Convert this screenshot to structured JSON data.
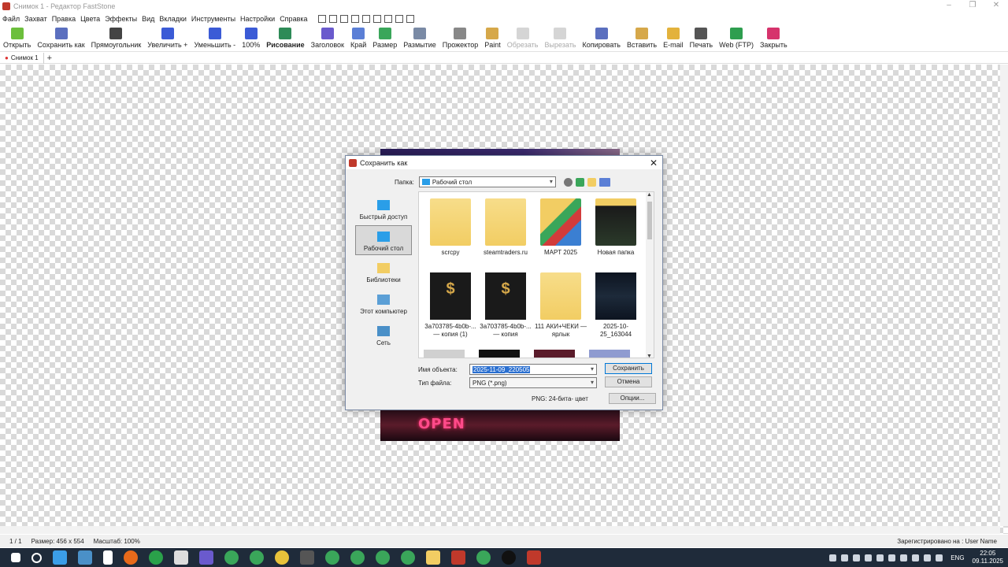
{
  "window": {
    "title": "Снимок 1 - Редактор FastStone",
    "controls": [
      "–",
      "❐",
      "✕"
    ]
  },
  "menu": [
    "Файл",
    "Захват",
    "Правка",
    "Цвета",
    "Эффекты",
    "Вид",
    "Вкладки",
    "Инструменты",
    "Настройки",
    "Справка"
  ],
  "toolbar": [
    {
      "label": "Открыть",
      "icon": "open-folder-icon",
      "color": "#6cbf3c",
      "disabled": false
    },
    {
      "label": "Сохранить как",
      "icon": "save-icon",
      "color": "#5b6fbf",
      "disabled": false
    },
    {
      "label": "Прямоугольник",
      "icon": "rectangle-select-icon",
      "color": "#444444",
      "disabled": false
    },
    {
      "label": "Увеличить +",
      "icon": "zoom-in-icon",
      "color": "#3b5bd6",
      "disabled": false
    },
    {
      "label": "Уменьшить -",
      "icon": "zoom-out-icon",
      "color": "#3b5bd6",
      "disabled": false
    },
    {
      "label": "100%",
      "icon": "zoom-100-icon",
      "color": "#3b5bd6",
      "disabled": false
    },
    {
      "label": "Рисование",
      "icon": "draw-icon",
      "color": "#2e8b57",
      "disabled": false,
      "bold": true
    },
    {
      "label": "Заголовок",
      "icon": "caption-icon",
      "color": "#6a5acd",
      "disabled": false
    },
    {
      "label": "Край",
      "icon": "edge-icon",
      "color": "#5b7fd6",
      "disabled": false
    },
    {
      "label": "Размер",
      "icon": "resize-icon",
      "color": "#3aa65a",
      "disabled": false
    },
    {
      "label": "Размытие",
      "icon": "blur-icon",
      "color": "#7a8aa5",
      "disabled": false
    },
    {
      "label": "Прожектор",
      "icon": "spotlight-icon",
      "color": "#888888",
      "disabled": false
    },
    {
      "label": "Paint",
      "icon": "paint-icon",
      "color": "#d6a84a",
      "disabled": false
    },
    {
      "label": "Обрезать",
      "icon": "crop-icon",
      "color": "#888888",
      "disabled": true
    },
    {
      "label": "Вырезать",
      "icon": "cut-icon",
      "color": "#888888",
      "disabled": true
    },
    {
      "label": "Копировать",
      "icon": "copy-icon",
      "color": "#5b6fbf",
      "disabled": false
    },
    {
      "label": "Вставить",
      "icon": "paste-icon",
      "color": "#d6a84a",
      "disabled": false
    },
    {
      "label": "E-mail",
      "icon": "email-icon",
      "color": "#e3b23c",
      "disabled": false
    },
    {
      "label": "Печать",
      "icon": "print-icon",
      "color": "#555555",
      "disabled": false
    },
    {
      "label": "Web (FTP)",
      "icon": "ftp-icon",
      "color": "#2e9e4f",
      "disabled": false
    },
    {
      "label": "Закрыть",
      "icon": "power-icon",
      "color": "#d6336c",
      "disabled": false
    }
  ],
  "tabs": [
    {
      "label": "Снимок 1"
    }
  ],
  "canvas_image": {
    "open_sign": "OPEN"
  },
  "status": {
    "page": "1 / 1",
    "size": "Размер: 456 x 554",
    "zoom": "Масштаб: 100%",
    "registered": "Зарегистрировано на : User Name"
  },
  "tray": {
    "lang": "ENG",
    "time": "22:05",
    "date": "09.11.2025"
  },
  "dialog": {
    "title": "Сохранить как",
    "folder_label": "Папка:",
    "folder_value": "Рабочий стол",
    "places": [
      {
        "label": "Быстрый доступ",
        "icon": "star-icon",
        "selected": false
      },
      {
        "label": "Рабочий стол",
        "icon": "desktop-icon",
        "selected": true
      },
      {
        "label": "Библиотеки",
        "icon": "library-icon",
        "selected": false
      },
      {
        "label": "Этот компьютер",
        "icon": "computer-icon",
        "selected": false
      },
      {
        "label": "Сеть",
        "icon": "network-icon",
        "selected": false
      }
    ],
    "files": [
      {
        "name": "scrcpy",
        "kind": "folder"
      },
      {
        "name": "steamtraders.ru",
        "kind": "folder"
      },
      {
        "name": "MAPT 2025",
        "kind": "folder-mapt"
      },
      {
        "name": "Новая папка",
        "kind": "folder-new"
      },
      {
        "name": "3a703785-4b0b-... — копия (1)",
        "kind": "shield"
      },
      {
        "name": "3a703785-4b0b-... — копия",
        "kind": "shield"
      },
      {
        "name": "111 АКИ+ЧЕКИ — ярлык",
        "kind": "folder"
      },
      {
        "name": "2025-10-25_163044",
        "kind": "dark"
      }
    ],
    "name_label": "Имя объекта:",
    "name_value": "2025-11-09_220505",
    "type_label": "Тип файла:",
    "type_value": "PNG (*.png)",
    "save_button": "Сохранить",
    "cancel_button": "Отмена",
    "png_info": "PNG: 24-бита- цвет",
    "options_button": "Опции..."
  }
}
